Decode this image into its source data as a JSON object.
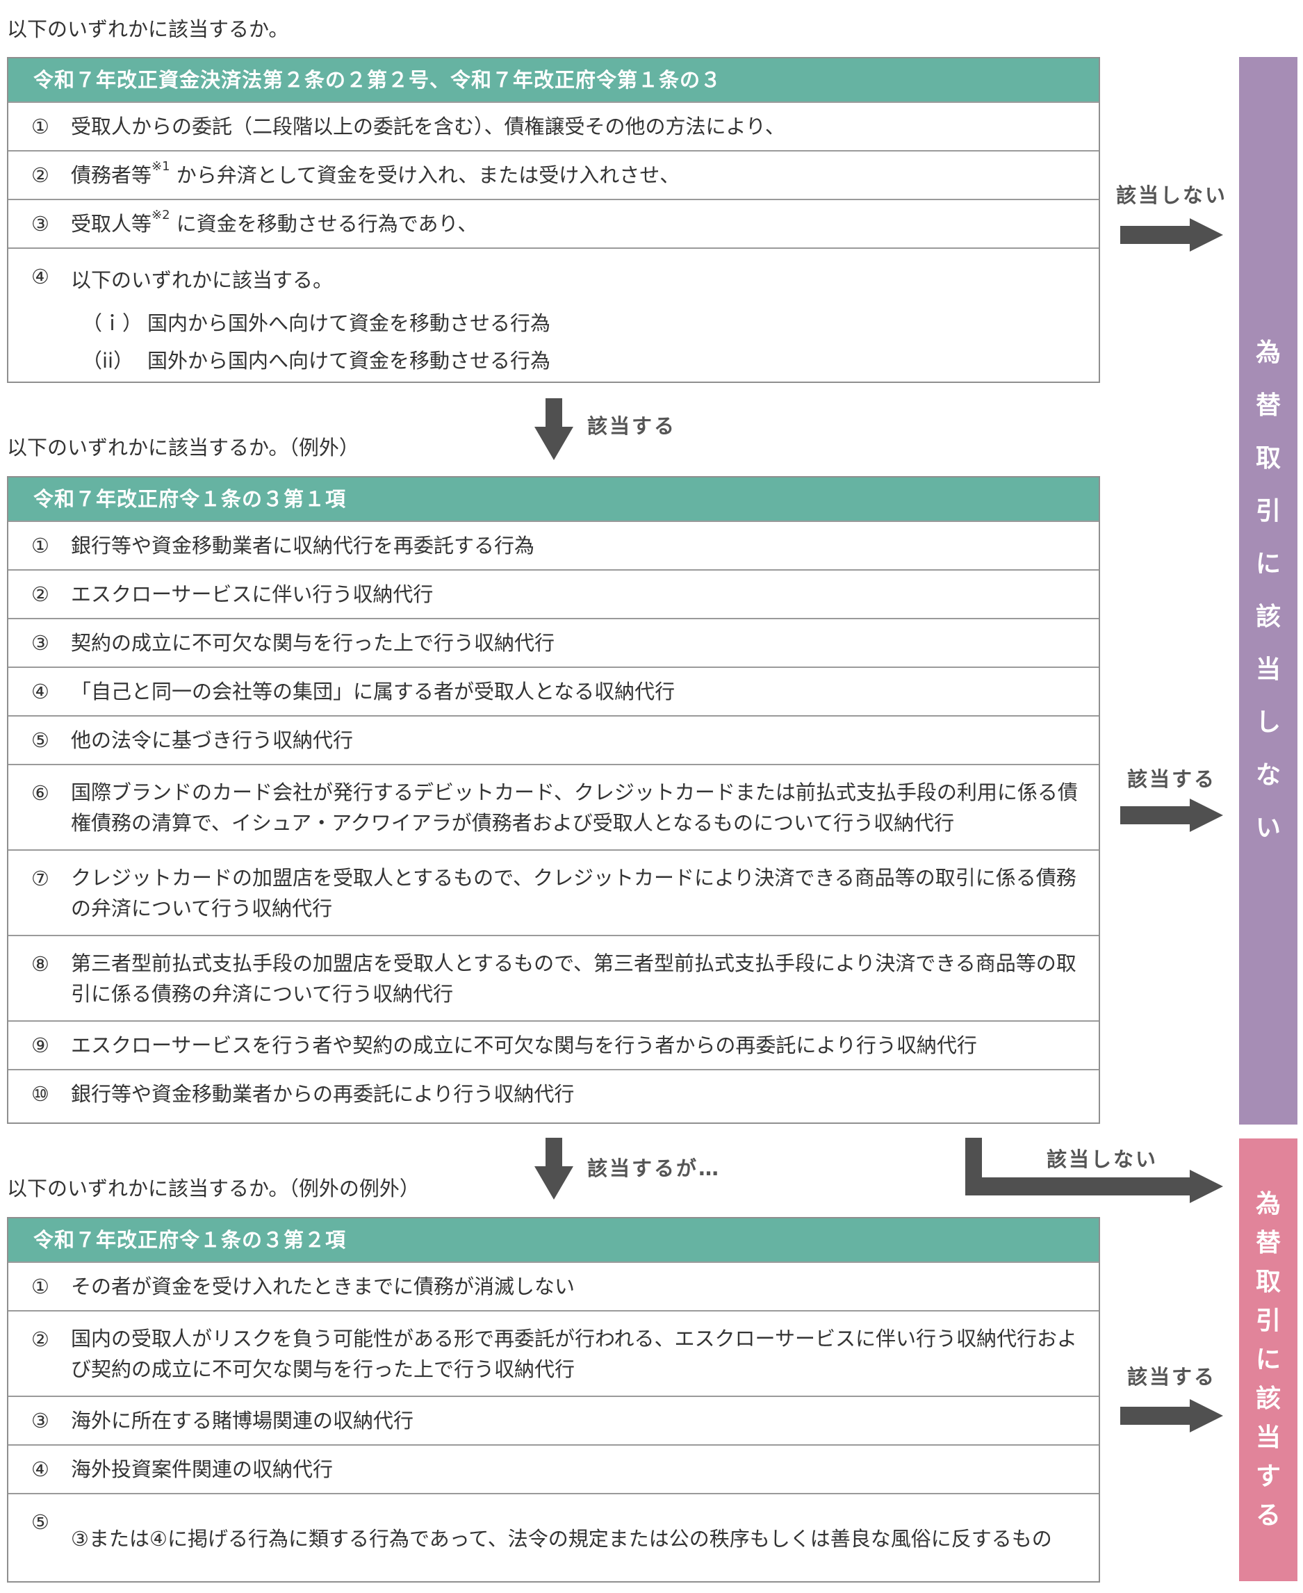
{
  "colors": {
    "teal": "#66b3a2",
    "purple": "#a68db5",
    "pink": "#e1849a",
    "arrow": "#505050"
  },
  "top_caption": "以下のいずれかに該当するか。",
  "box1": {
    "title": "令和７年改正資金決済法第２条の２第２号、令和７年改正府令第１条の３",
    "rows": [
      {
        "num": "①",
        "pre": "受取人からの委託（二段階以上の委託を含む）、債権譲受その他の方法により、",
        "sup": "",
        "post": ""
      },
      {
        "num": "②",
        "pre": "債務者等",
        "sup": "※1",
        "post": " から弁済として資金を受け入れ、または受け入れさせ、"
      },
      {
        "num": "③",
        "pre": "受取人等",
        "sup": "※2",
        "post": " に資金を移動させる行為であり、"
      }
    ],
    "row4": {
      "num": "④",
      "text": "以下のいずれかに該当する。",
      "subs": [
        {
          "label": "（ｉ）",
          "text": "国内から国外へ向けて資金を移動させる行為"
        },
        {
          "label": "（ii）",
          "text": "国外から国内へ向けて資金を移動させる行為"
        }
      ]
    }
  },
  "flow": {
    "not_applicable_1": "該当しない",
    "applicable_1": "該当する",
    "applicable_2": "該当する",
    "applicable_but": "該当するが…",
    "not_applicable_2": "該当しない",
    "applicable_3": "該当する"
  },
  "caption_exception": "以下のいずれかに該当するか。（例外）",
  "box2": {
    "title": "令和７年改正府令１条の３第１項",
    "rows": [
      {
        "num": "①",
        "text": "銀行等や資金移動業者に収納代行を再委託する行為"
      },
      {
        "num": "②",
        "text": "エスクローサービスに伴い行う収納代行"
      },
      {
        "num": "③",
        "text": "契約の成立に不可欠な関与を行った上で行う収納代行"
      },
      {
        "num": "④",
        "text": "「自己と同一の会社等の集団」に属する者が受取人となる収納代行"
      },
      {
        "num": "⑤",
        "text": "他の法令に基づき行う収納代行"
      },
      {
        "num": "⑥",
        "text": "国際ブランドのカード会社が発行するデビットカード、クレジットカードまたは前払式支払手段の利用に係る債権債務の清算で、イシュア・アクワイアラが債務者および受取人となるものについて行う収納代行"
      },
      {
        "num": "⑦",
        "text": "クレジットカードの加盟店を受取人とするもので、クレジットカードにより決済できる商品等の取引に係る債務の弁済について行う収納代行"
      },
      {
        "num": "⑧",
        "text": "第三者型前払式支払手段の加盟店を受取人とするもので、第三者型前払式支払手段により決済できる商品等の取引に係る債務の弁済について行う収納代行"
      },
      {
        "num": "⑨",
        "text": "エスクローサービスを行う者や契約の成立に不可欠な関与を行う者からの再委託により行う収納代行"
      },
      {
        "num": "⑩",
        "text": "銀行等や資金移動業者からの再委託により行う収納代行"
      }
    ]
  },
  "caption_exception2": "以下のいずれかに該当するか。（例外の例外）",
  "box3": {
    "title": "令和７年改正府令１条の３第２項",
    "rows": [
      {
        "num": "①",
        "text": "その者が資金を受け入れたときまでに債務が消滅しない"
      },
      {
        "num": "②",
        "text": "国内の受取人がリスクを負う可能性がある形で再委託が行われる、エスクローサービスに伴い行う収納代行および契約の成立に不可欠な関与を行った上で行う収納代行"
      },
      {
        "num": "③",
        "text": "海外に所在する賭博場関連の収納代行"
      },
      {
        "num": "④",
        "text": "海外投資案件関連の収納代行"
      },
      {
        "num": "⑤",
        "text": "③または④に掲げる行為に類する行為であって、法令の規定または公の秩序もしくは善良な風俗に反するもの"
      }
    ]
  },
  "result_not": "為替取引に該当しない",
  "result_yes": "為替取引に該当する"
}
